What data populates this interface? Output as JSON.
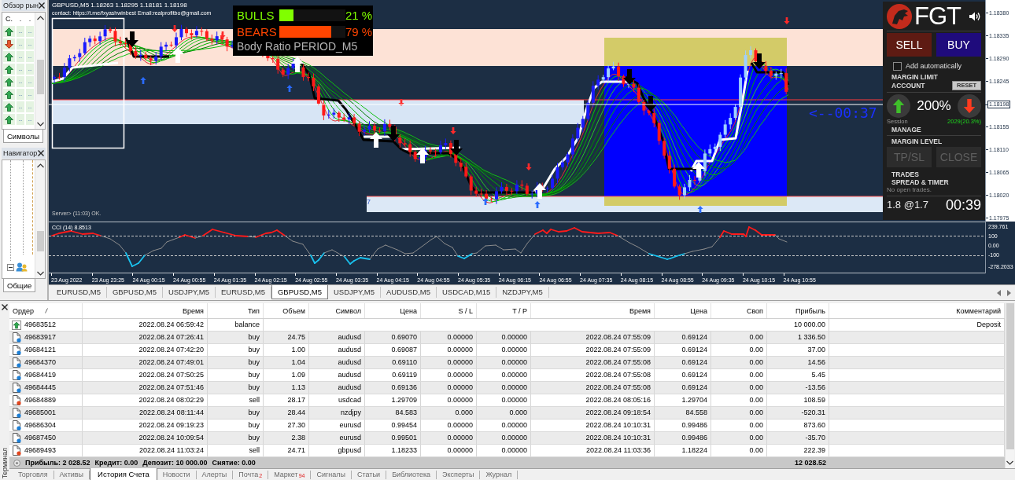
{
  "market_watch": {
    "title": "Обзор рын",
    "columns": [
      "С.",
      ".",
      "."
    ],
    "rows": [
      {
        "kind": "up",
        "bid": "..",
        "ask": ".."
      },
      {
        "kind": "down",
        "bid": "..",
        "ask": ".."
      },
      {
        "kind": "up",
        "bid": "..",
        "ask": ".."
      },
      {
        "kind": "up",
        "bid": "..",
        "ask": ".."
      },
      {
        "kind": "up",
        "bid": "..",
        "ask": ".."
      },
      {
        "kind": "up",
        "bid": "..",
        "ask": ".."
      },
      {
        "kind": "up",
        "bid": "..",
        "ask": ".."
      },
      {
        "kind": "up",
        "bid": "..",
        "ask": ".."
      }
    ],
    "tab": "Символы"
  },
  "navigator": {
    "title": "Навигатор",
    "tab": "Общие"
  },
  "chart": {
    "header": "GBPUSD,M5 1.18263 1.18295 1.18181 1.18198",
    "contact": "contact: https://t.me/fxyashwinbest Email:realprofitbo@gmail.com",
    "server_status": "Server> (11:03) OK.",
    "zone_label": "7",
    "countdown": "<--00:37",
    "price_axis": [
      {
        "kind": "tick",
        "label": "1.18380"
      },
      {
        "kind": "tick",
        "label": "1.18335"
      },
      {
        "kind": "tick",
        "label": "1.18290"
      },
      {
        "kind": "tick",
        "label": "1.18245"
      },
      {
        "kind": "current",
        "label": "1.18198"
      },
      {
        "kind": "tick",
        "label": "1.18155"
      },
      {
        "kind": "tick",
        "label": "1.18110"
      },
      {
        "kind": "tick",
        "label": "1.18065"
      },
      {
        "kind": "tick",
        "label": "1.18020"
      },
      {
        "kind": "tick",
        "label": "1.17975"
      }
    ],
    "indicator": {
      "title": "CCI (14) 8.8513",
      "axis": [
        "239.761",
        "100",
        "0.00",
        "-100",
        "-278.2033"
      ]
    },
    "time_axis": [
      "23 Aug 2022",
      "23 Aug 23:25",
      "24 Aug 00:15",
      "24 Aug 00:55",
      "24 Aug 01:35",
      "24 Aug 02:15",
      "24 Aug 02:55",
      "24 Aug 03:35",
      "24 Aug 04:15",
      "24 Aug 04:55",
      "24 Aug 05:35",
      "24 Aug 06:15",
      "24 Aug 06:55",
      "24 Aug 07:35",
      "24 Aug 08:15",
      "24 Aug 08:55",
      "24 Aug 09:35",
      "24 Aug 10:15",
      "24 Aug 10:55"
    ]
  },
  "strength_box": {
    "rows": [
      {
        "label": "BULLS",
        "color": "#80ff00",
        "level": 0.21,
        "reading": "21 %"
      },
      {
        "label": "BEARS",
        "color": "#ff4500",
        "level": 0.79,
        "reading": "79 %"
      }
    ],
    "caption": "Body Ratio PERIOD_M5"
  },
  "trade_panel": {
    "logo": "FGT",
    "sell": "SELL",
    "buy": "BUY",
    "auto_add": {
      "label": "Add automatically",
      "checked": false
    },
    "margin_limit": "MARGIN LIMIT",
    "account": "ACCOUNT",
    "reset": "RESET",
    "ratio": "200%",
    "session": "Session",
    "session_value": "2029(20.3%)",
    "manage": "MANAGE",
    "margin_level": "MARGIN LEVEL",
    "buttons": [
      {
        "label": "TP/SL",
        "disabled": true
      },
      {
        "label": "CLOSE",
        "disabled": true
      }
    ],
    "trades": "TRADES",
    "spread_timer": "SPREAD & TIMER",
    "no_trades": "No open trades.",
    "spread": "1.8 @1.7",
    "timer": "00:39"
  },
  "chart_tabs": [
    {
      "label": "EURUSD,M5",
      "selected": false
    },
    {
      "label": "GBPUSD,M5",
      "selected": false
    },
    {
      "label": "USDJPY,M5",
      "selected": false
    },
    {
      "label": "EURUSD,M5",
      "selected": false
    },
    {
      "label": "GBPUSD,M5",
      "selected": true
    },
    {
      "label": "USDJPY,M5",
      "selected": false
    },
    {
      "label": "AUDUSD,M5",
      "selected": false
    },
    {
      "label": "USDCAD,M15",
      "selected": false
    },
    {
      "label": "NZDJPY,M5",
      "selected": false
    }
  ],
  "history": {
    "columns": [
      {
        "label": "Ордер",
        "sorted": true
      },
      {
        "label": "Время",
        "sorted": false
      },
      {
        "label": "Тип",
        "sorted": false
      },
      {
        "label": "Объем",
        "sorted": false
      },
      {
        "label": "Символ",
        "sorted": false
      },
      {
        "label": "Цена",
        "sorted": false
      },
      {
        "label": "S / L",
        "sorted": false
      },
      {
        "label": "T / P",
        "sorted": false
      },
      {
        "label": "Время",
        "sorted": false
      },
      {
        "label": "Цена",
        "sorted": false
      },
      {
        "label": "Своп",
        "sorted": false
      },
      {
        "label": "Прибыль",
        "sorted": false
      },
      {
        "label": "Комментарий",
        "sorted": false
      }
    ],
    "rows": [
      {
        "kind": "balance",
        "order": "49683512",
        "open_time": "2022.08.24 06:59:42",
        "type": "balance",
        "profit": "10 000.00",
        "comment": "Deposit"
      },
      {
        "kind": "buy",
        "order": "49683917",
        "open_time": "2022.08.24 07:26:41",
        "type": "buy",
        "volume": "24.75",
        "symbol": "audusd",
        "open_price": "0.69070",
        "sl": "0.00000",
        "tp": "0.00000",
        "close_time": "2022.08.24 07:55:09",
        "close_price": "0.69124",
        "swap": "0.00",
        "profit": "1 336.50"
      },
      {
        "kind": "buy",
        "order": "49684121",
        "open_time": "2022.08.24 07:42:20",
        "type": "buy",
        "volume": "1.00",
        "symbol": "audusd",
        "open_price": "0.69087",
        "sl": "0.00000",
        "tp": "0.00000",
        "close_time": "2022.08.24 07:55:09",
        "close_price": "0.69124",
        "swap": "0.00",
        "profit": "37.00"
      },
      {
        "kind": "buy",
        "order": "49684370",
        "open_time": "2022.08.24 07:49:01",
        "type": "buy",
        "volume": "1.04",
        "symbol": "audusd",
        "open_price": "0.69110",
        "sl": "0.00000",
        "tp": "0.00000",
        "close_time": "2022.08.24 07:55:08",
        "close_price": "0.69124",
        "swap": "0.00",
        "profit": "14.56"
      },
      {
        "kind": "buy",
        "order": "49684419",
        "open_time": "2022.08.24 07:50:25",
        "type": "buy",
        "volume": "1.09",
        "symbol": "audusd",
        "open_price": "0.69119",
        "sl": "0.00000",
        "tp": "0.00000",
        "close_time": "2022.08.24 07:55:08",
        "close_price": "0.69124",
        "swap": "0.00",
        "profit": "5.45"
      },
      {
        "kind": "buy",
        "order": "49684445",
        "open_time": "2022.08.24 07:51:46",
        "type": "buy",
        "volume": "1.13",
        "symbol": "audusd",
        "open_price": "0.69136",
        "sl": "0.00000",
        "tp": "0.00000",
        "close_time": "2022.08.24 07:55:08",
        "close_price": "0.69124",
        "swap": "0.00",
        "profit": "-13.56"
      },
      {
        "kind": "sell",
        "order": "49684889",
        "open_time": "2022.08.24 08:02:29",
        "type": "sell",
        "volume": "28.17",
        "symbol": "usdcad",
        "open_price": "1.29709",
        "sl": "0.00000",
        "tp": "0.00000",
        "close_time": "2022.08.24 08:05:16",
        "close_price": "1.29704",
        "swap": "0.00",
        "profit": "108.59"
      },
      {
        "kind": "buy",
        "order": "49685001",
        "open_time": "2022.08.24 08:11:44",
        "type": "buy",
        "volume": "28.44",
        "symbol": "nzdjpy",
        "open_price": "84.583",
        "sl": "0.000",
        "tp": "0.000",
        "close_time": "2022.08.24 09:18:54",
        "close_price": "84.558",
        "swap": "0.00",
        "profit": "-520.31"
      },
      {
        "kind": "buy",
        "order": "49686304",
        "open_time": "2022.08.24 09:19:23",
        "type": "buy",
        "volume": "27.30",
        "symbol": "eurusd",
        "open_price": "0.99454",
        "sl": "0.00000",
        "tp": "0.00000",
        "close_time": "2022.08.24 10:10:31",
        "close_price": "0.99486",
        "swap": "0.00",
        "profit": "873.60"
      },
      {
        "kind": "buy",
        "order": "49687450",
        "open_time": "2022.08.24 10:09:54",
        "type": "buy",
        "volume": "2.38",
        "symbol": "eurusd",
        "open_price": "0.99501",
        "sl": "0.00000",
        "tp": "0.00000",
        "close_time": "2022.08.24 10:10:31",
        "close_price": "0.99486",
        "swap": "0.00",
        "profit": "-35.70"
      },
      {
        "kind": "sell",
        "order": "49689493",
        "open_time": "2022.08.24 11:03:24",
        "type": "sell",
        "volume": "24.71",
        "symbol": "gbpusd",
        "open_price": "1.18233",
        "sl": "0.00000",
        "tp": "0.00000",
        "close_time": "2022.08.24 11:03:36",
        "close_price": "1.18224",
        "swap": "0.00",
        "profit": "222.39"
      }
    ],
    "summary": [
      "Прибыль: 2 028.52",
      "Кредит: 0.00",
      "Депозит: 10 000.00",
      "Снятие: 0.00"
    ],
    "total": "12 028.52"
  },
  "terminal": {
    "title": "Терминал",
    "tabs": [
      {
        "label": "Торговля",
        "selected": false
      },
      {
        "label": "Активы",
        "selected": false
      },
      {
        "label": "История Счета",
        "selected": true
      },
      {
        "label": "Новости",
        "selected": false
      },
      {
        "label": "Алерты",
        "selected": false
      },
      {
        "label": "Почта",
        "badge": "2",
        "selected": false
      },
      {
        "label": "Маркет",
        "badge": "94",
        "selected": false
      },
      {
        "label": "Сигналы",
        "selected": false
      },
      {
        "label": "Статьи",
        "selected": false
      },
      {
        "label": "Библиотека",
        "selected": false
      },
      {
        "label": "Эксперты",
        "selected": false
      },
      {
        "label": "Журнал",
        "selected": false
      }
    ]
  }
}
